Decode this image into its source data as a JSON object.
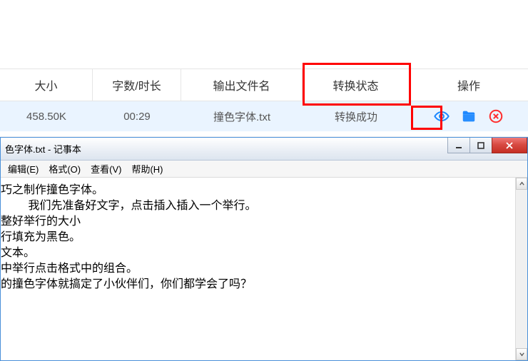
{
  "table": {
    "headers": {
      "size": "大小",
      "count": "字数/时长",
      "outname": "输出文件名",
      "status": "转换状态",
      "ops": "操作"
    },
    "row": {
      "size": "458.50K",
      "count": "00:29",
      "outname": "撞色字体.txt",
      "status": "转换成功"
    },
    "icons": {
      "preview": "eye-icon",
      "open_folder": "folder-icon",
      "delete": "delete-icon"
    }
  },
  "notepad": {
    "title": "色字体.txt - 记事本",
    "menus": {
      "edit": "编辑(E)",
      "format": "格式(O)",
      "view": "查看(V)",
      "help": "帮助(H)"
    },
    "content": "巧之制作撞色字体。\n    我们先准备好文字，点击插入插入一个举行。\n整好举行的大小\n行填充为黑色。\n文本。\n中举行点击格式中的组合。\n的撞色字体就搞定了小伙伴们，你们都学会了吗？"
  }
}
